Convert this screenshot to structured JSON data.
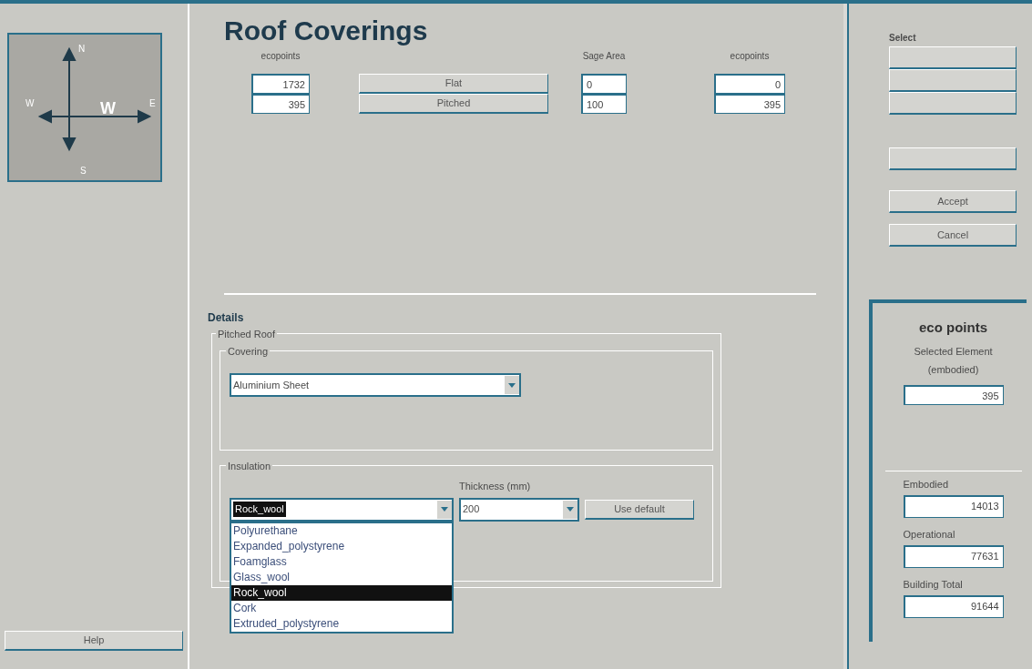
{
  "compass": {
    "labels": [
      {
        "kind": "n",
        "text": "N"
      },
      {
        "kind": "w",
        "text": "W"
      },
      {
        "kind": "center",
        "text": "W"
      },
      {
        "kind": "e",
        "text": "E"
      },
      {
        "kind": "s",
        "text": "S"
      }
    ]
  },
  "sidebar": {
    "help_button": "Help"
  },
  "title": "Roof Coverings",
  "summary": {
    "left_header": "ecopoints",
    "left_values": [
      "1732",
      "395"
    ],
    "buttons": [
      {
        "label": "Flat"
      },
      {
        "label": "Pitched"
      }
    ],
    "area_header": "Sage Area",
    "area_values": [
      "0",
      "100"
    ],
    "right_header": "ecopoints",
    "right_values": [
      "0",
      "395"
    ]
  },
  "details": {
    "heading": "Details",
    "group": "Pitched Roof",
    "covering": {
      "label": "Covering",
      "value": "Aluminium Sheet"
    },
    "insulation": {
      "label": "Insulation",
      "value": "Rock_wool",
      "thickness_label": "Thickness (mm)",
      "thickness_value": "200",
      "default_button": "Use default",
      "options": [
        {
          "label": "Polyurethane",
          "selected": false
        },
        {
          "label": "Expanded_polystyrene",
          "selected": false
        },
        {
          "label": "Foamglass",
          "selected": false
        },
        {
          "label": "Glass_wool",
          "selected": false
        },
        {
          "label": "Rock_wool",
          "selected": true
        },
        {
          "label": "Cork",
          "selected": false
        },
        {
          "label": "Extruded_polystyrene",
          "selected": false
        }
      ]
    }
  },
  "actions": {
    "select_label": "Select",
    "accept": "Accept",
    "cancel": "Cancel"
  },
  "eco_points": {
    "title": "eco points",
    "selected_label": "Selected Element",
    "selected_sub": "(embodied)",
    "selected_value": "395",
    "totals": [
      {
        "label": "Embodied",
        "value": "14013"
      },
      {
        "label": "Operational",
        "value": "77631"
      },
      {
        "label": "Building Total",
        "value": "91644"
      }
    ]
  }
}
